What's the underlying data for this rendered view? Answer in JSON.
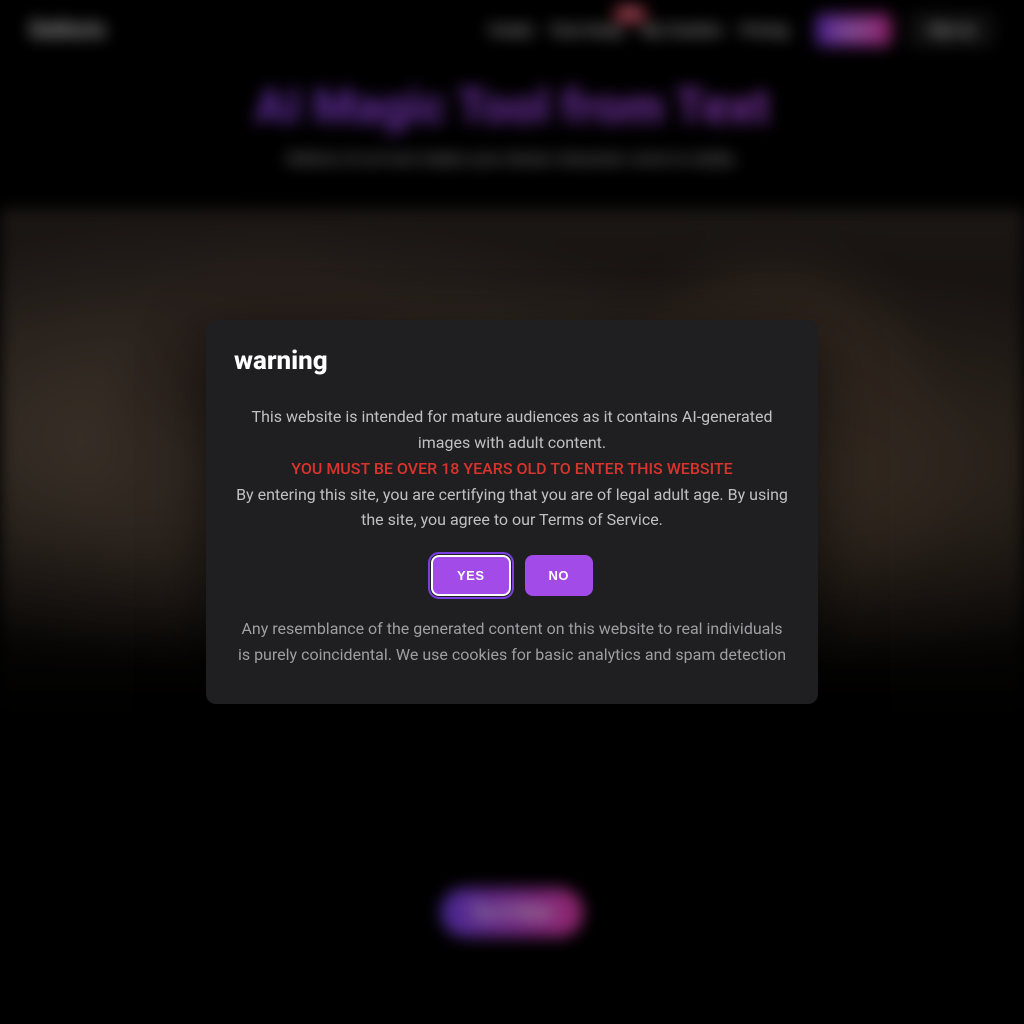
{
  "brand": "Delloris",
  "nav": {
    "create": "Create",
    "faceswap": "Face Swap",
    "faceswap_badge": "NEW",
    "mycreation": "My Creation",
    "pricing": "Pricing",
    "login": "Log in",
    "signup": "Sign up"
  },
  "hero": {
    "title": "AI Magic Tool from Text",
    "subtitle": "Delloris AI art tool makes your dream character come to reality."
  },
  "cta": {
    "label": "Try It Now"
  },
  "modal": {
    "title": "warning",
    "intro": "This website is intended for mature audiences as it contains AI-generated images with adult content.",
    "age_line": "YOU MUST BE OVER 18 YEARS OLD TO ENTER THIS WEBSITE",
    "consent": "By entering this site, you are certifying that you are of legal adult age. By using the site, you agree to our Terms of Service.",
    "yes": "YES",
    "no": "NO",
    "disclaimer": "Any resemblance of the generated content on this website to real individuals is purely coincidental. We use cookies for basic analytics and spam detection"
  }
}
